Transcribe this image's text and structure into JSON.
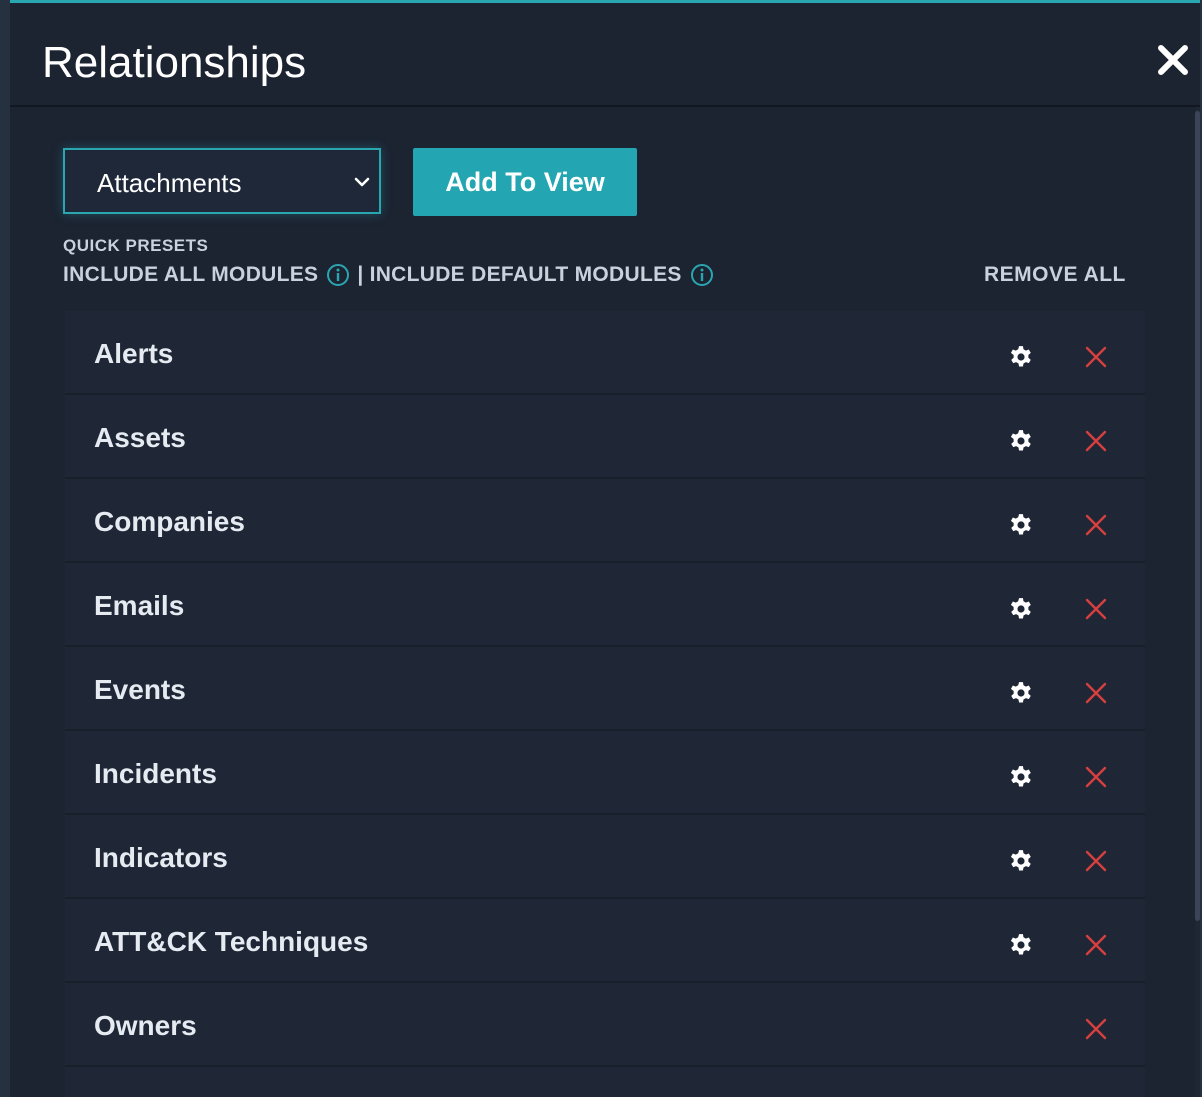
{
  "title": "Relationships",
  "close_icon": "close-icon",
  "module_select": {
    "value": "Attachments",
    "icon": "chevron-down-icon"
  },
  "add_button_label": "Add To View",
  "presets": {
    "label": "QUICK PRESETS",
    "include_all": "INCLUDE ALL MODULES",
    "separator": "|",
    "include_default": "INCLUDE DEFAULT MODULES",
    "info_icon": "info-icon"
  },
  "remove_all_label": "REMOVE ALL",
  "items": [
    {
      "label": "Alerts",
      "has_settings": true
    },
    {
      "label": "Assets",
      "has_settings": true
    },
    {
      "label": "Companies",
      "has_settings": true
    },
    {
      "label": "Emails",
      "has_settings": true
    },
    {
      "label": "Events",
      "has_settings": true
    },
    {
      "label": "Incidents",
      "has_settings": true
    },
    {
      "label": "Indicators",
      "has_settings": true
    },
    {
      "label": "ATT&CK Techniques",
      "has_settings": true
    },
    {
      "label": "Owners",
      "has_settings": false
    }
  ],
  "colors": {
    "accent": "#23a6b1",
    "background": "#1c2331",
    "row_background": "#1f2736",
    "remove": "#d6403f",
    "text": "#e6ebf2"
  }
}
